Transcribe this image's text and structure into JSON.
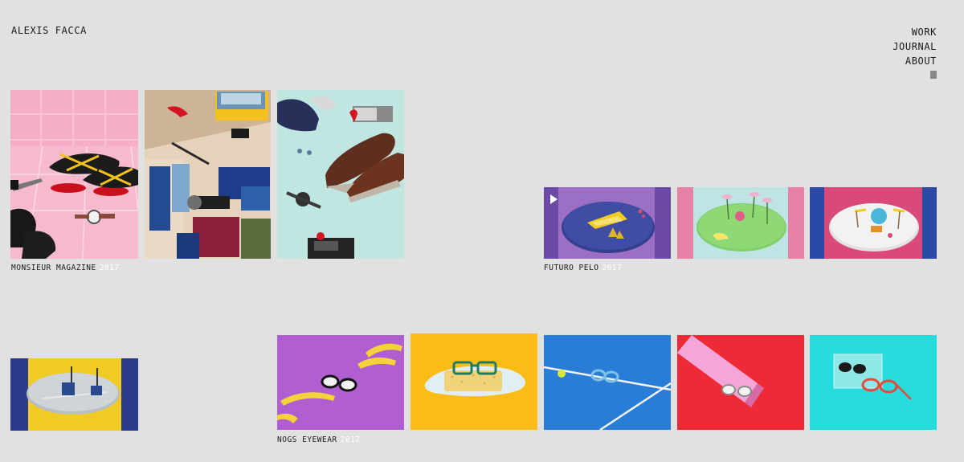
{
  "site": {
    "title": "ALEXIS FACCA"
  },
  "nav": {
    "items": [
      "WORK",
      "JOURNAL",
      "ABOUT"
    ]
  },
  "projects": [
    {
      "name": "MONSIEUR MAGAZINE",
      "year": "2017"
    },
    {
      "name": "FUTURO PELO",
      "year": "2017"
    },
    {
      "name": "NOGS EYEWEAR",
      "year": "2017"
    }
  ],
  "colors": {
    "background": "#e1e1e1",
    "text": "#1a1a1a",
    "year": "#ffffff"
  },
  "icons": {
    "video": "play-icon",
    "scroll": "scroll-indicator-icon"
  }
}
